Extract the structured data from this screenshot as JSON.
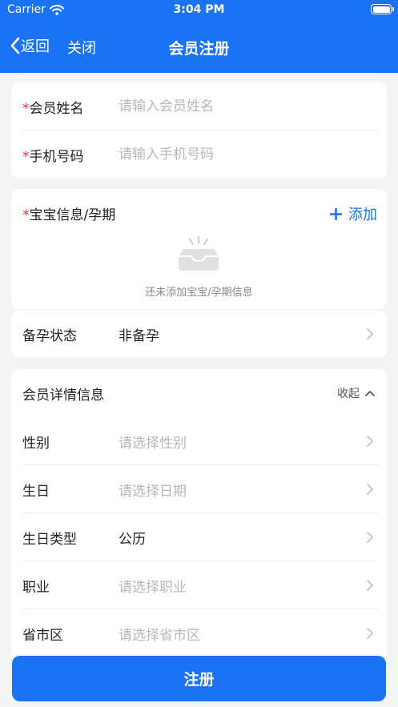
{
  "status_bar": {
    "carrier": "Carrier",
    "time": "3:04 PM"
  },
  "nav": {
    "back_label": "返回",
    "close_label": "关闭",
    "title": "会员注册"
  },
  "basic": {
    "required_mark": "*",
    "name_label": "会员姓名",
    "name_placeholder": "请输入会员姓名",
    "phone_label": "手机号码",
    "phone_placeholder": "请输入手机号码"
  },
  "baby": {
    "required_mark": "*",
    "label": "宝宝信息/孕期",
    "add_label": "添加",
    "empty_text": "还未添加宝宝/孕期信息"
  },
  "pregnancy": {
    "label": "备孕状态",
    "value": "非备孕"
  },
  "details": {
    "title": "会员详情信息",
    "collapse_label": "收起",
    "rows": [
      {
        "label": "性别",
        "value": "请选择性别",
        "placeholder": true
      },
      {
        "label": "生日",
        "value": "请选择日期",
        "placeholder": true
      },
      {
        "label": "生日类型",
        "value": "公历",
        "placeholder": false
      },
      {
        "label": "职业",
        "value": "请选择职业",
        "placeholder": true
      },
      {
        "label": "省市区",
        "value": "请选择省市区",
        "placeholder": true
      }
    ]
  },
  "submit_label": "注册",
  "colors": {
    "primary": "#1a73f5",
    "required": "#e53935",
    "background": "#f3f4f6",
    "placeholder": "#b4b7bd"
  }
}
